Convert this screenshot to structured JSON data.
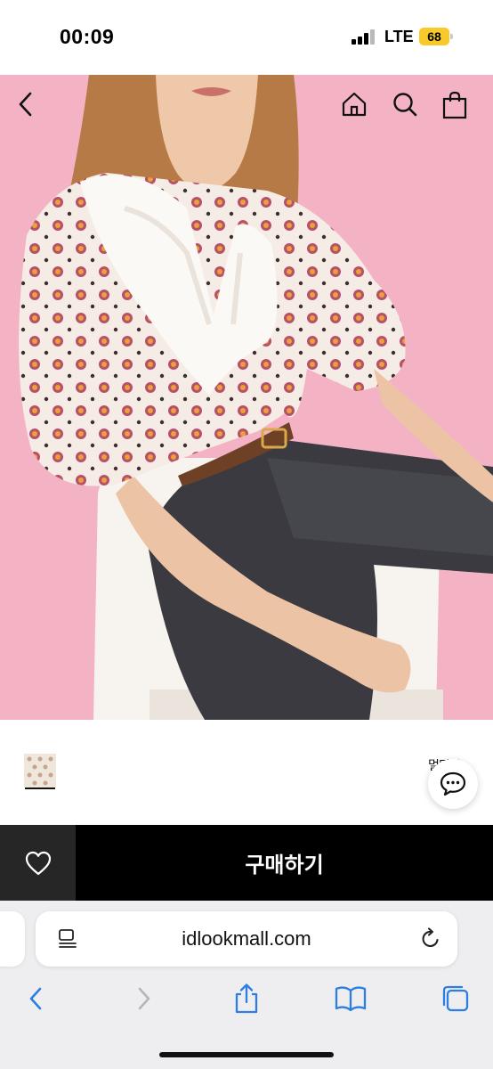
{
  "status_bar": {
    "time": "00:09",
    "network": "LTE",
    "battery": "68"
  },
  "product": {
    "image_alt": "Woman wearing a printed blouse with a white lace collar",
    "side_label": "멀티줄"
  },
  "actions": {
    "buy_label": "구매하기"
  },
  "browser": {
    "url": "idlookmall.com"
  },
  "colors": {
    "hero_background": "#f3b3c4",
    "buy_bar": "#000000",
    "wish_button": "#262626",
    "safari_accent": "#2c7fe0",
    "battery": "#f8ca29"
  },
  "icons": {
    "hero_nav": [
      "back-arrow-icon",
      "home-icon",
      "search-icon",
      "shopping-bag-icon"
    ],
    "buy_bar": [
      "heart-icon"
    ],
    "chat": "chat-bubble-icon",
    "safari_toolbar": [
      "back-icon",
      "forward-icon",
      "share-icon",
      "bookmarks-icon",
      "tabs-icon"
    ]
  }
}
